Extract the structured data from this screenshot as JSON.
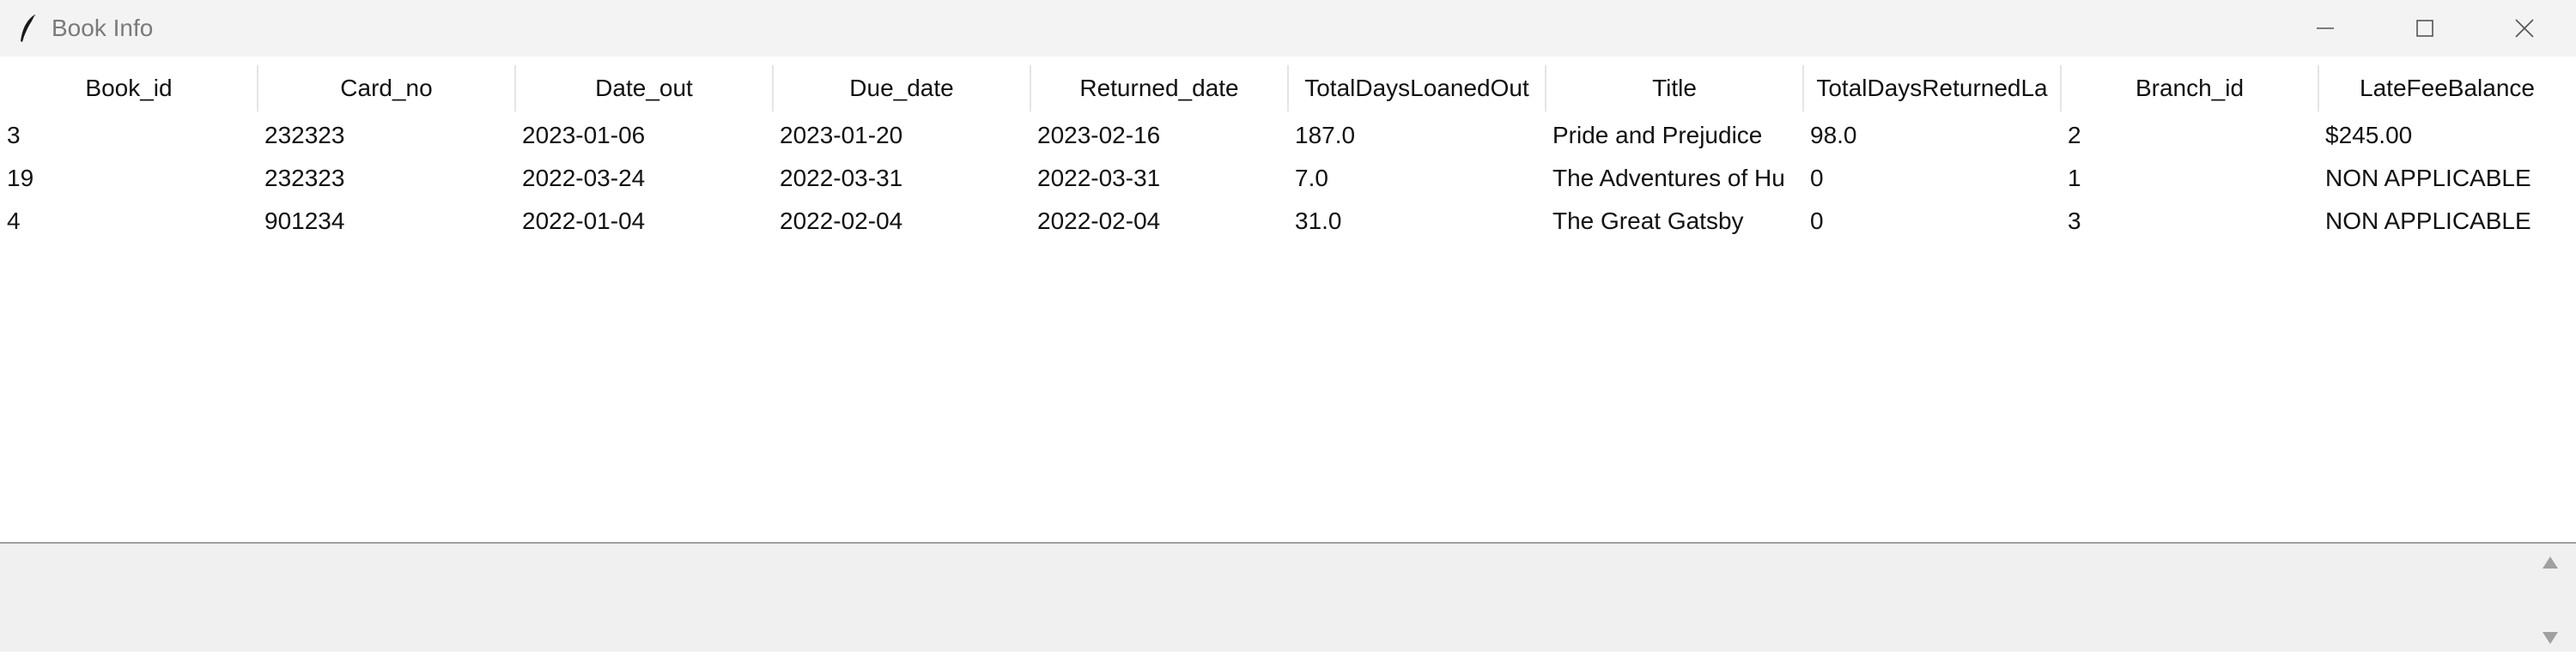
{
  "window": {
    "title": "Book Info"
  },
  "columns": [
    "Book_id",
    "Card_no",
    "Date_out",
    "Due_date",
    "Returned_date",
    "TotalDaysLoanedOut",
    "Title",
    "TotalDaysReturnedLa",
    "Branch_id",
    "LateFeeBalance"
  ],
  "rows": [
    [
      "3",
      "232323",
      "2023-01-06",
      "2023-01-20",
      "2023-02-16",
      "187.0",
      "Pride and Prejudice",
      "98.0",
      "2",
      "$245.00"
    ],
    [
      "19",
      "232323",
      "2022-03-24",
      "2022-03-31",
      "2022-03-31",
      "7.0",
      "The Adventures of Hu",
      "0",
      "1",
      "NON APPLICABLE"
    ],
    [
      "4",
      "901234",
      "2022-01-04",
      "2022-02-04",
      "2022-02-04",
      "31.0",
      "The Great Gatsby",
      "0",
      "3",
      "NON APPLICABLE"
    ]
  ],
  "icons": {
    "app": "feather-icon",
    "minimize": "minimize-icon",
    "maximize": "maximize-icon",
    "close": "close-icon",
    "scroll_up": "scroll-up-arrow-icon",
    "scroll_down": "scroll-down-arrow-icon"
  }
}
